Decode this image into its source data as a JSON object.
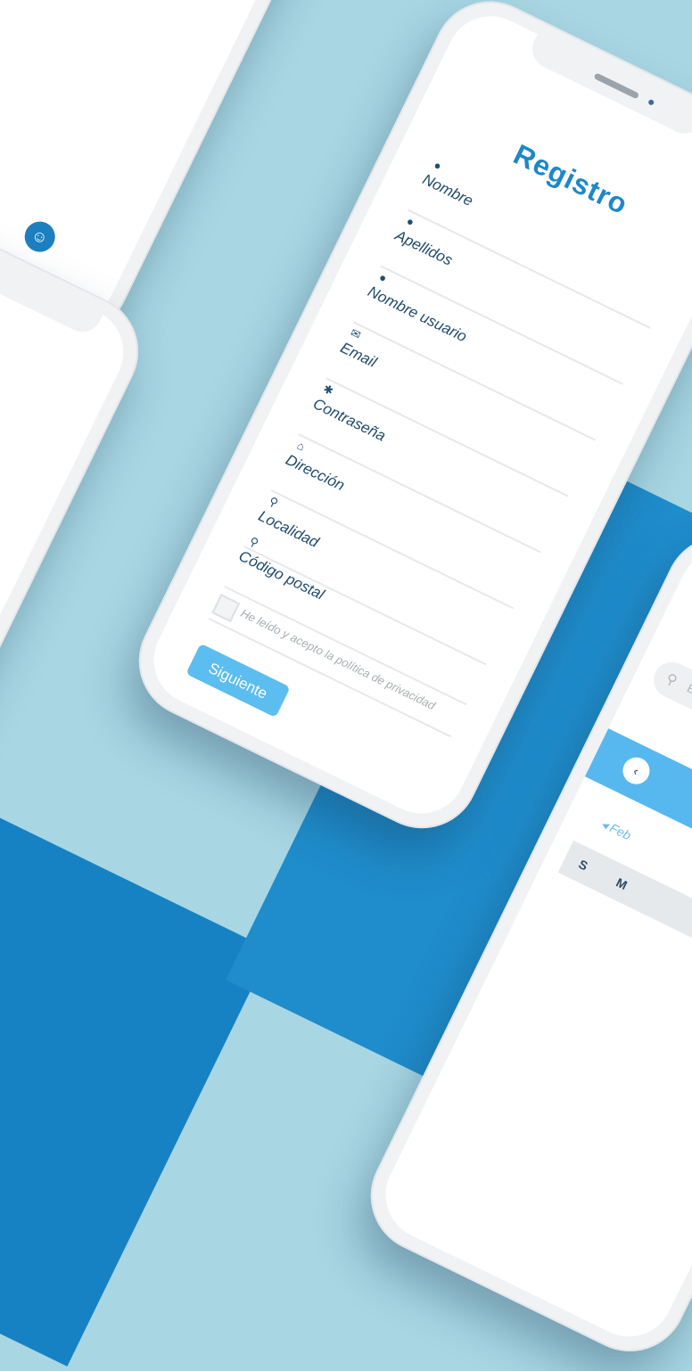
{
  "register": {
    "title": "Registro",
    "fields": [
      {
        "label": "Nombre",
        "icon": "user-icon"
      },
      {
        "label": "Apellidos",
        "icon": "user-icon"
      },
      {
        "label": "Nombre usuario",
        "icon": "user-icon"
      },
      {
        "label": "Email",
        "icon": "envelope-icon"
      },
      {
        "label": "Contraseña",
        "icon": "asterisk-icon"
      },
      {
        "label": "Dirección",
        "icon": "home-icon"
      },
      {
        "label": "Localidad",
        "icon": "pin-icon"
      },
      {
        "label": "Código postal",
        "icon": "pin-icon"
      }
    ],
    "privacy_label": "He leído y acepto la política de privacidad",
    "next_label": "Siguiente"
  },
  "colors": {
    "background": "#a9d6e3",
    "accent": "#1e88c7",
    "button": "#5cbdf0",
    "dark_blue": "#1682c3"
  },
  "side_phone": {
    "search_placeholder": "Bu",
    "calendar_month": "Feb",
    "weekdays": [
      "S",
      "M"
    ]
  }
}
